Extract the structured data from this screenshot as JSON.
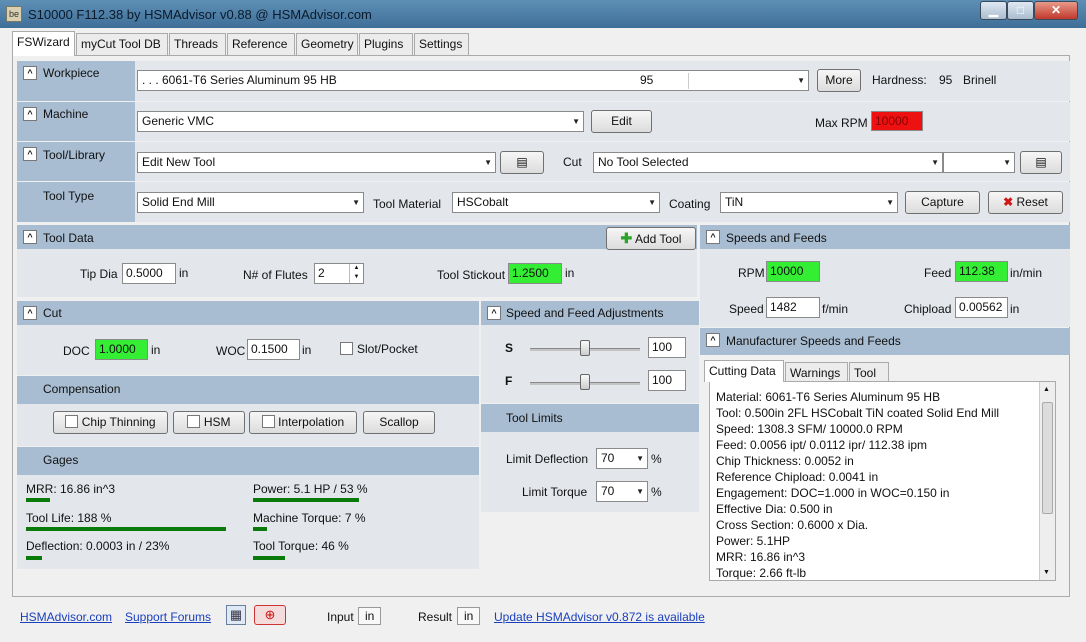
{
  "window": {
    "title": "S10000 F112.38 by HSMAdvisor v0.88 @ HSMAdvisor.com",
    "icon": "app-icon",
    "min": "▁",
    "max": "□",
    "close": "✕"
  },
  "tabs": [
    "FSWizard",
    "myCut Tool DB",
    "Threads",
    "Reference",
    "Geometry",
    "Plugins",
    "Settings"
  ],
  "workpiece": {
    "label": "Workpiece",
    "material": ". . . 6061-T6 Series Aluminum 95 HB",
    "hardness_value": "95",
    "more": "More",
    "hardness_label": "Hardness:",
    "hardness": "95",
    "hardness_unit": "Brinell"
  },
  "machine": {
    "label": "Machine",
    "value": "Generic VMC",
    "edit": "Edit",
    "maxrpm_label": "Max RPM",
    "maxrpm": "10000"
  },
  "tool_library": {
    "label": "Tool/Library",
    "value": "Edit New Tool",
    "cut_label": "Cut",
    "cut_value": "No Tool Selected"
  },
  "tool_type": {
    "label": "Tool Type",
    "value": "Solid End Mill",
    "material_label": "Tool Material",
    "material": "HSCobalt",
    "coating_label": "Coating",
    "coating": "TiN",
    "capture": "Capture",
    "reset": "Reset"
  },
  "tool_data": {
    "label": "Tool Data",
    "add_tool": "Add Tool",
    "tipdia_label": "Tip Dia",
    "tipdia": "0.5000",
    "tipdia_unit": "in",
    "flutes_label": "N# of Flutes",
    "flutes": "2",
    "stickout_label": "Tool Stickout",
    "stickout": "1.2500",
    "stickout_unit": "in"
  },
  "speeds_feeds": {
    "label": "Speeds and Feeds",
    "rpm_label": "RPM",
    "rpm": "10000",
    "feed_label": "Feed",
    "feed": "112.38",
    "feed_unit": "in/min",
    "speed_label": "Speed",
    "speed": "1482",
    "speed_unit": "f/min",
    "chipload_label": "Chipload",
    "chipload": "0.00562",
    "chipload_unit": "in"
  },
  "cut": {
    "label": "Cut",
    "doc_label": "DOC",
    "doc": "1.0000",
    "doc_unit": "in",
    "woc_label": "WOC",
    "woc": "0.1500",
    "woc_unit": "in",
    "slot_label": "Slot/Pocket"
  },
  "compensation": {
    "label": "Compensation",
    "chip_thinning": "Chip Thinning",
    "hsm": "HSM",
    "interpolation": "Interpolation",
    "scallop": "Scallop"
  },
  "adjust": {
    "label": "Speed and Feed Adjustments",
    "s_label": "S",
    "s_value": "100",
    "s_level": 0.5,
    "f_label": "F",
    "f_value": "100",
    "f_level": 0.5
  },
  "limits": {
    "label": "Tool Limits",
    "deflection_label": "Limit Deflection",
    "deflection": "70",
    "deflection_unit": "%",
    "torque_label": "Limit Torque",
    "torque": "70",
    "torque_unit": "%"
  },
  "gages": {
    "label": "Gages",
    "items": [
      {
        "text": "MRR: 16.86 in^3",
        "level": 0.12
      },
      {
        "text": "Power: 5.1 HP / 53 %",
        "level": 0.53
      },
      {
        "text": "Tool Life: 188 %",
        "level": 1.0
      },
      {
        "text": "Machine Torque: 7 %",
        "level": 0.07
      },
      {
        "text": "Deflection: 0.0003 in / 23%",
        "level": 0.08
      },
      {
        "text": "Tool Torque: 46 %",
        "level": 0.16
      }
    ]
  },
  "manufacturer": {
    "label": "Manufacturer Speeds and Feeds",
    "tabs": [
      "Cutting Data",
      "Warnings",
      "Tool"
    ],
    "lines": [
      "Material: 6061-T6 Series Aluminum 95 HB",
      "Tool: 0.500in 2FL HSCobalt TiN coated Solid End Mill",
      "Speed: 1308.3 SFM/ 10000.0 RPM",
      "Feed: 0.0056 ipt/ 0.0112 ipr/ 112.38 ipm",
      "Chip Thickness: 0.0052 in",
      "Reference Chipload: 0.0041 in",
      "Engagement: DOC=1.000 in   WOC=0.150 in",
      "Effective Dia: 0.500 in",
      "Cross Section: 0.6000 x Dia.",
      "Power: 5.1HP",
      "MRR: 16.86 in^3",
      "Torque: 2.66 ft-lb"
    ]
  },
  "footer": {
    "site": "HSMAdvisor.com",
    "forums": "Support Forums",
    "input_label": "Input",
    "input_unit": "in",
    "result_label": "Result",
    "result_unit": "in",
    "update": "Update HSMAdvisor v0.872 is available"
  },
  "colors": {
    "highlight_green": "#33ee33",
    "alert_red": "#ee1111",
    "header_blue": "#a9bdd2"
  }
}
